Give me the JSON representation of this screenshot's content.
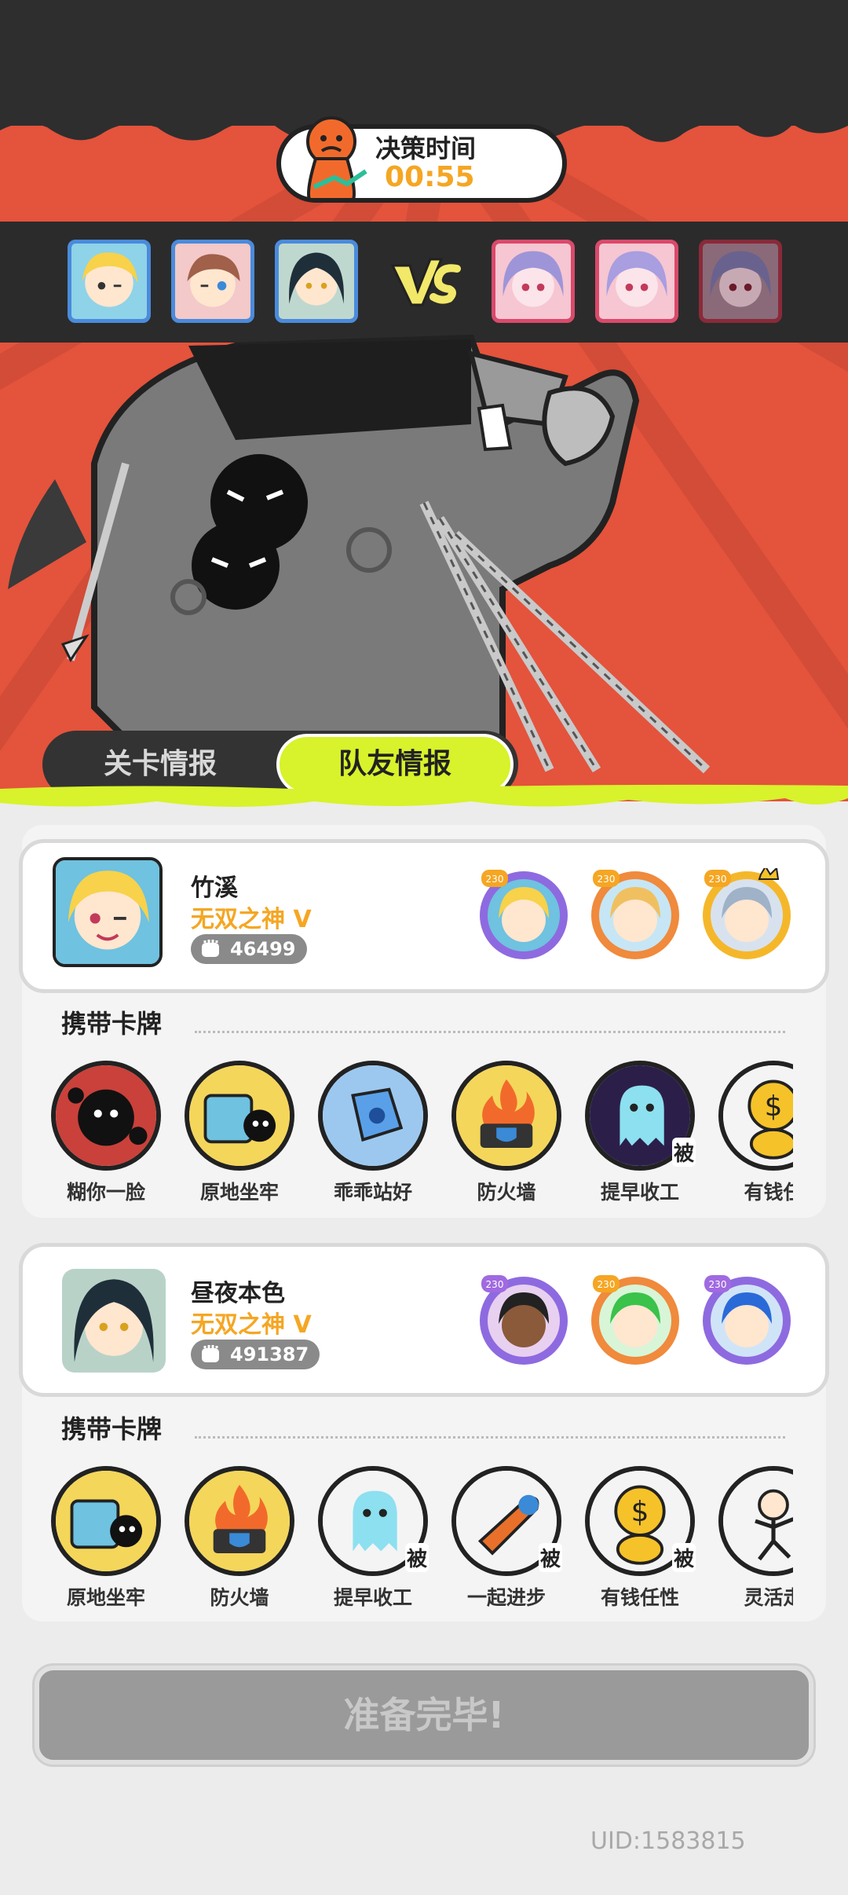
{
  "decision": {
    "title": "决策时间",
    "time": "00:55"
  },
  "teams": {
    "allies": [
      "blonde-hero-portrait",
      "brown-hair-hero-portrait",
      "dark-hair-hero-portrait"
    ],
    "enemies": [
      "lavender-hair-boss-portrait",
      "lavender-hair-boss-portrait",
      "dark-lavender-boss-portrait"
    ],
    "vs_icon": "vs-icon"
  },
  "tabs": {
    "level_info": "关卡情报",
    "team_info": "队友情报",
    "active": "team_info"
  },
  "players": [
    {
      "name": "竹溪",
      "title": "无双之神 V",
      "power": "46499",
      "heroes": [
        {
          "level": "230",
          "icon": "blonde-hero-icon"
        },
        {
          "level": "230",
          "icon": "orange-hair-hero-icon"
        },
        {
          "level": "230",
          "icon": "silver-hair-hero-icon"
        }
      ],
      "cards_title": "携带卡牌",
      "cards": [
        {
          "label": "糊你一脸",
          "passive": ""
        },
        {
          "label": "原地坐牢",
          "passive": ""
        },
        {
          "label": "乖乖站好",
          "passive": ""
        },
        {
          "label": "防火墙",
          "passive": ""
        },
        {
          "label": "提早收工",
          "passive": "被"
        },
        {
          "label": "有钱任",
          "passive": ""
        }
      ]
    },
    {
      "name": "昼夜本色",
      "title": "无双之神 V",
      "power": "491387",
      "heroes": [
        {
          "level": "230",
          "icon": "dark-skin-hero-icon"
        },
        {
          "level": "230",
          "icon": "green-hair-hero-icon"
        },
        {
          "level": "230",
          "icon": "blue-hair-hero-icon"
        }
      ],
      "cards_title": "携带卡牌",
      "cards": [
        {
          "label": "原地坐牢",
          "passive": ""
        },
        {
          "label": "防火墙",
          "passive": ""
        },
        {
          "label": "提早收工",
          "passive": "被"
        },
        {
          "label": "一起进步",
          "passive": "被"
        },
        {
          "label": "有钱任性",
          "passive": "被"
        },
        {
          "label": "灵活走",
          "passive": ""
        }
      ]
    }
  ],
  "ready_button": "准备完毕!",
  "uid": "UID:1583815",
  "colors": {
    "accent_lime": "#d8f22b",
    "title_orange": "#f5a623",
    "background_red": "#e4533c"
  }
}
